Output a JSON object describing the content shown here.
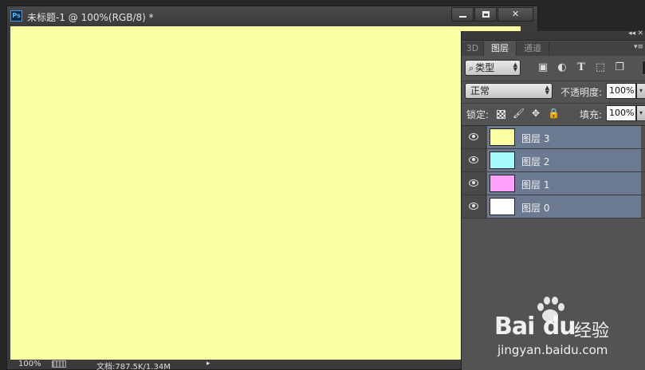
{
  "document": {
    "ps_logo": "Ps",
    "title": "未标题-1 @ 100%(RGB/8) *",
    "canvas_color": "#fbffa2",
    "status": {
      "zoom": "100%",
      "doc_info": "文档:787.5K/1.34M",
      "arrow": "▸"
    }
  },
  "panel": {
    "tabs": [
      {
        "label": "3D"
      },
      {
        "label": "图层"
      },
      {
        "label": "通道"
      }
    ],
    "active_tab": "图层",
    "filter": {
      "kind_label": "类型",
      "icons": [
        "image-filter-icon",
        "adjustment-filter-icon",
        "type-filter-icon",
        "shape-filter-icon",
        "smart-object-filter-icon"
      ]
    },
    "blend_mode": "正常",
    "opacity": {
      "label": "不透明度:",
      "value": "100%"
    },
    "lock": {
      "label": "锁定:"
    },
    "fill": {
      "label": "填充:",
      "value": "100%"
    },
    "layers": [
      {
        "name": "图层 3",
        "thumb_color": "#fbffa2"
      },
      {
        "name": "图层 2",
        "thumb_color": "#a6fbff"
      },
      {
        "name": "图层 1",
        "thumb_color": "#ffa2fb"
      },
      {
        "name": "图层 0",
        "thumb_color": "#ffffff"
      }
    ]
  },
  "watermark": {
    "brand": "Bai",
    "brand2": "du",
    "cn": "经验",
    "url": "jingyan.baidu.com"
  }
}
